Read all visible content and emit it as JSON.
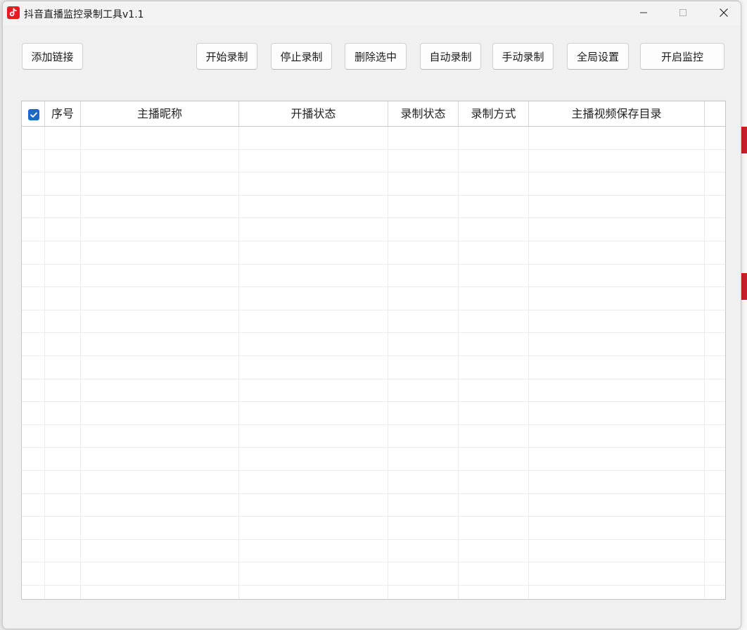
{
  "window": {
    "title": "抖音直播监控录制工具v1.1",
    "controls": [
      "minimize-icon",
      "maximize-icon",
      "close-icon"
    ]
  },
  "toolbar": {
    "add_link": "添加链接",
    "start_record": "开始录制",
    "stop_record": "停止录制",
    "delete_selected": "删除选中",
    "auto_record": "自动录制",
    "manual_record": "手动录制",
    "global_settings": "全局设置",
    "start_monitor": "开启监控"
  },
  "table": {
    "select_all_checked": true,
    "columns": [
      "序号",
      "主播昵称",
      "开播状态",
      "录制状态",
      "录制方式",
      "主播视频保存目录"
    ],
    "rows": []
  },
  "colors": {
    "accent": "#1f66c8",
    "app_icon": "#e31b23"
  }
}
